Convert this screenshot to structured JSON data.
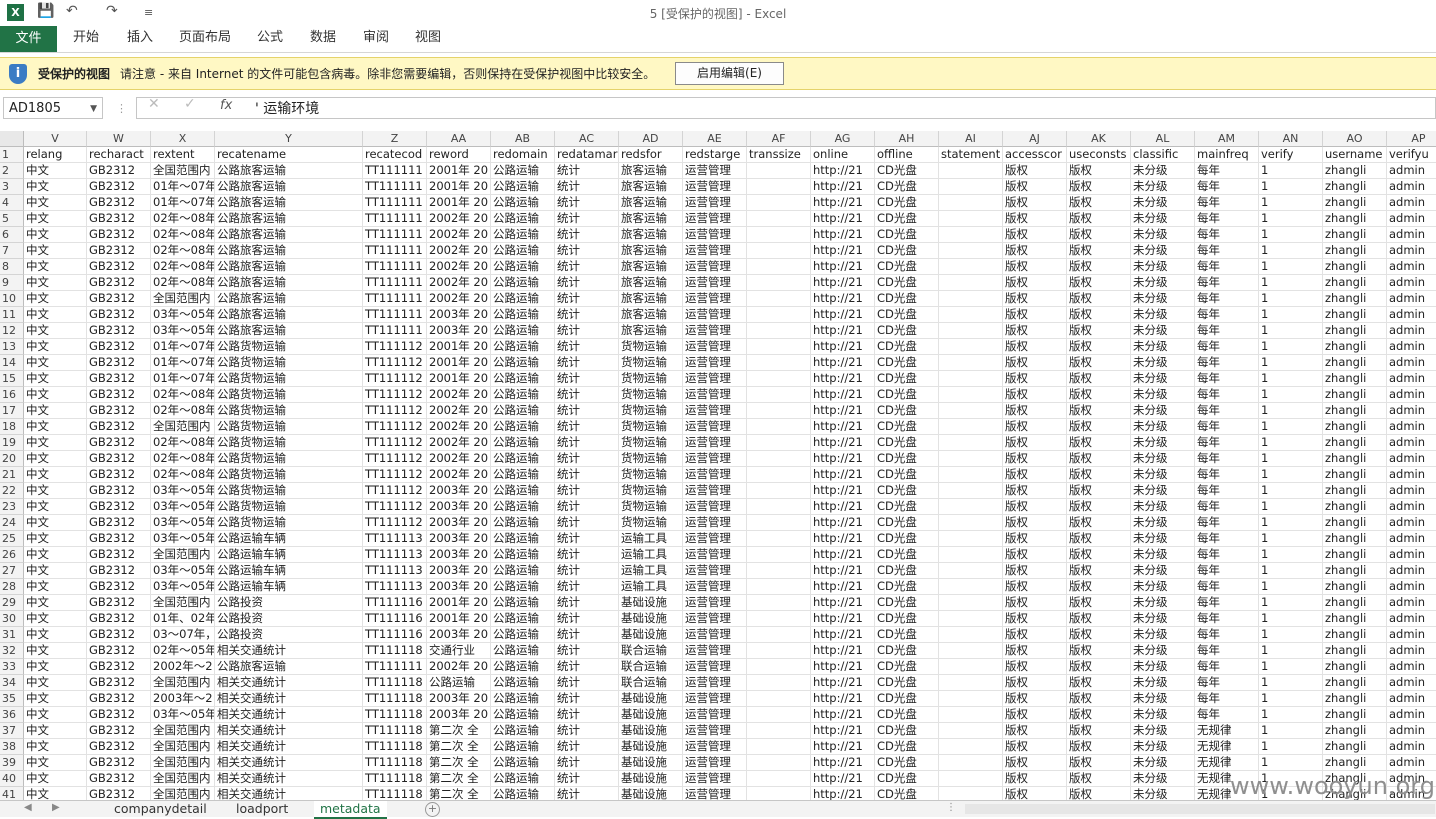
{
  "app": {
    "title": "5  [受保护的视图] - Excel",
    "logo": "X"
  },
  "quick_access": {
    "save_icon": "save-icon",
    "undo_icon": "undo-icon",
    "redo_icon": "redo-icon",
    "more": "≡"
  },
  "ribbon": {
    "file": "文件",
    "tabs": [
      "开始",
      "插入",
      "页面布局",
      "公式",
      "数据",
      "审阅",
      "视图"
    ]
  },
  "protected_bar": {
    "title": "受保护的视图",
    "message": "请注意 - 来自 Internet 的文件可能包含病毒。除非您需要编辑，否则保持在受保护视图中比较安全。",
    "button": "启用编辑(E)"
  },
  "formula_bar": {
    "name_box": "AD1805",
    "fx": "fx",
    "value": "' 运输环境"
  },
  "columns": [
    "V",
    "W",
    "X",
    "Y",
    "Z",
    "AA",
    "AB",
    "AC",
    "AD",
    "AE",
    "AF",
    "AG",
    "AH",
    "AI",
    "AJ",
    "AK",
    "AL",
    "AM",
    "AN",
    "AO",
    "AP"
  ],
  "header_row": [
    "relang",
    "recharact",
    "rextent",
    "recatename",
    "recatecod",
    "reword",
    "redomain",
    "redatamar",
    "redsfor",
    "redstarge",
    "transsize",
    "online",
    "offline",
    "statement",
    "accesscor",
    "useconsts",
    "classific",
    "mainfreq",
    "verify",
    "username",
    "verifyu"
  ],
  "rows": [
    [
      "1"
    ],
    [
      "2",
      "中文",
      "GB2312",
      "全国范围内",
      "公路旅客运输",
      "TT111111",
      "2001年  20",
      "公路运输",
      "统计",
      "旅客运输",
      "运营管理",
      "",
      "http://21",
      "CD光盘",
      "",
      "版权",
      "版权",
      "未分级",
      "每年",
      "1",
      "zhangli",
      "admin"
    ],
    [
      "3",
      "中文",
      "GB2312",
      "01年～07年",
      "公路旅客运输",
      "TT111111",
      "2001年  20",
      "公路运输",
      "统计",
      "旅客运输",
      "运营管理",
      "",
      "http://21",
      "CD光盘",
      "",
      "版权",
      "版权",
      "未分级",
      "每年",
      "1",
      "zhangli",
      "admin"
    ],
    [
      "4",
      "中文",
      "GB2312",
      "01年～07年",
      "公路旅客运输",
      "TT111111",
      "2001年  20",
      "公路运输",
      "统计",
      "旅客运输",
      "运营管理",
      "",
      "http://21",
      "CD光盘",
      "",
      "版权",
      "版权",
      "未分级",
      "每年",
      "1",
      "zhangli",
      "admin"
    ],
    [
      "5",
      "中文",
      "GB2312",
      "02年～08年",
      "公路旅客运输",
      "TT111111",
      "2002年  20",
      "公路运输",
      "统计",
      "旅客运输",
      "运营管理",
      "",
      "http://21",
      "CD光盘",
      "",
      "版权",
      "版权",
      "未分级",
      "每年",
      "1",
      "zhangli",
      "admin"
    ],
    [
      "6",
      "中文",
      "GB2312",
      "02年～08年",
      "公路旅客运输",
      "TT111111",
      "2002年  20",
      "公路运输",
      "统计",
      "旅客运输",
      "运营管理",
      "",
      "http://21",
      "CD光盘",
      "",
      "版权",
      "版权",
      "未分级",
      "每年",
      "1",
      "zhangli",
      "admin"
    ],
    [
      "7",
      "中文",
      "GB2312",
      "02年～08年",
      "公路旅客运输",
      "TT111111",
      "2002年  20",
      "公路运输",
      "统计",
      "旅客运输",
      "运营管理",
      "",
      "http://21",
      "CD光盘",
      "",
      "版权",
      "版权",
      "未分级",
      "每年",
      "1",
      "zhangli",
      "admin"
    ],
    [
      "8",
      "中文",
      "GB2312",
      "02年～08年",
      "公路旅客运输",
      "TT111111",
      "2002年  20",
      "公路运输",
      "统计",
      "旅客运输",
      "运营管理",
      "",
      "http://21",
      "CD光盘",
      "",
      "版权",
      "版权",
      "未分级",
      "每年",
      "1",
      "zhangli",
      "admin"
    ],
    [
      "9",
      "中文",
      "GB2312",
      "02年～08年",
      "公路旅客运输",
      "TT111111",
      "2002年  20",
      "公路运输",
      "统计",
      "旅客运输",
      "运营管理",
      "",
      "http://21",
      "CD光盘",
      "",
      "版权",
      "版权",
      "未分级",
      "每年",
      "1",
      "zhangli",
      "admin"
    ],
    [
      "10",
      "中文",
      "GB2312",
      "全国范围内",
      "公路旅客运输",
      "TT111111",
      "2002年  20",
      "公路运输",
      "统计",
      "旅客运输",
      "运营管理",
      "",
      "http://21",
      "CD光盘",
      "",
      "版权",
      "版权",
      "未分级",
      "每年",
      "1",
      "zhangli",
      "admin"
    ],
    [
      "11",
      "中文",
      "GB2312",
      "03年～05年",
      "公路旅客运输",
      "TT111111",
      "2003年  20",
      "公路运输",
      "统计",
      "旅客运输",
      "运营管理",
      "",
      "http://21",
      "CD光盘",
      "",
      "版权",
      "版权",
      "未分级",
      "每年",
      "1",
      "zhangli",
      "admin"
    ],
    [
      "12",
      "中文",
      "GB2312",
      "03年～05年",
      "公路旅客运输",
      "TT111111",
      "2003年  20",
      "公路运输",
      "统计",
      "旅客运输",
      "运营管理",
      "",
      "http://21",
      "CD光盘",
      "",
      "版权",
      "版权",
      "未分级",
      "每年",
      "1",
      "zhangli",
      "admin"
    ],
    [
      "13",
      "中文",
      "GB2312",
      "01年～07年",
      "公路货物运输",
      "TT111112",
      "2001年  20",
      "公路运输",
      "统计",
      "货物运输",
      "运营管理",
      "",
      "http://21",
      "CD光盘",
      "",
      "版权",
      "版权",
      "未分级",
      "每年",
      "1",
      "zhangli",
      "admin"
    ],
    [
      "14",
      "中文",
      "GB2312",
      "01年～07年",
      "公路货物运输",
      "TT111112",
      "2001年  20",
      "公路运输",
      "统计",
      "货物运输",
      "运营管理",
      "",
      "http://21",
      "CD光盘",
      "",
      "版权",
      "版权",
      "未分级",
      "每年",
      "1",
      "zhangli",
      "admin"
    ],
    [
      "15",
      "中文",
      "GB2312",
      "01年～07年",
      "公路货物运输",
      "TT111112",
      "2001年  20",
      "公路运输",
      "统计",
      "货物运输",
      "运营管理",
      "",
      "http://21",
      "CD光盘",
      "",
      "版权",
      "版权",
      "未分级",
      "每年",
      "1",
      "zhangli",
      "admin"
    ],
    [
      "16",
      "中文",
      "GB2312",
      "02年～08年",
      "公路货物运输",
      "TT111112",
      "2002年  20",
      "公路运输",
      "统计",
      "货物运输",
      "运营管理",
      "",
      "http://21",
      "CD光盘",
      "",
      "版权",
      "版权",
      "未分级",
      "每年",
      "1",
      "zhangli",
      "admin"
    ],
    [
      "17",
      "中文",
      "GB2312",
      "02年～08年",
      "公路货物运输",
      "TT111112",
      "2002年  20",
      "公路运输",
      "统计",
      "货物运输",
      "运营管理",
      "",
      "http://21",
      "CD光盘",
      "",
      "版权",
      "版权",
      "未分级",
      "每年",
      "1",
      "zhangli",
      "admin"
    ],
    [
      "18",
      "中文",
      "GB2312",
      "全国范围内",
      "公路货物运输",
      "TT111112",
      "2002年  20",
      "公路运输",
      "统计",
      "货物运输",
      "运营管理",
      "",
      "http://21",
      "CD光盘",
      "",
      "版权",
      "版权",
      "未分级",
      "每年",
      "1",
      "zhangli",
      "admin"
    ],
    [
      "19",
      "中文",
      "GB2312",
      "02年～08年",
      "公路货物运输",
      "TT111112",
      "2002年  20",
      "公路运输",
      "统计",
      "货物运输",
      "运营管理",
      "",
      "http://21",
      "CD光盘",
      "",
      "版权",
      "版权",
      "未分级",
      "每年",
      "1",
      "zhangli",
      "admin"
    ],
    [
      "20",
      "中文",
      "GB2312",
      "02年～08年",
      "公路货物运输",
      "TT111112",
      "2002年  20",
      "公路运输",
      "统计",
      "货物运输",
      "运营管理",
      "",
      "http://21",
      "CD光盘",
      "",
      "版权",
      "版权",
      "未分级",
      "每年",
      "1",
      "zhangli",
      "admin"
    ],
    [
      "21",
      "中文",
      "GB2312",
      "02年～08年",
      "公路货物运输",
      "TT111112",
      "2002年  20",
      "公路运输",
      "统计",
      "货物运输",
      "运营管理",
      "",
      "http://21",
      "CD光盘",
      "",
      "版权",
      "版权",
      "未分级",
      "每年",
      "1",
      "zhangli",
      "admin"
    ],
    [
      "22",
      "中文",
      "GB2312",
      "03年～05年",
      "公路货物运输",
      "TT111112",
      "2003年  20",
      "公路运输",
      "统计",
      "货物运输",
      "运营管理",
      "",
      "http://21",
      "CD光盘",
      "",
      "版权",
      "版权",
      "未分级",
      "每年",
      "1",
      "zhangli",
      "admin"
    ],
    [
      "23",
      "中文",
      "GB2312",
      "03年～05年",
      "公路货物运输",
      "TT111112",
      "2003年  20",
      "公路运输",
      "统计",
      "货物运输",
      "运营管理",
      "",
      "http://21",
      "CD光盘",
      "",
      "版权",
      "版权",
      "未分级",
      "每年",
      "1",
      "zhangli",
      "admin"
    ],
    [
      "24",
      "中文",
      "GB2312",
      "03年～05年",
      "公路货物运输",
      "TT111112",
      "2003年  20",
      "公路运输",
      "统计",
      "货物运输",
      "运营管理",
      "",
      "http://21",
      "CD光盘",
      "",
      "版权",
      "版权",
      "未分级",
      "每年",
      "1",
      "zhangli",
      "admin"
    ],
    [
      "25",
      "中文",
      "GB2312",
      "03年～05年",
      "公路运输车辆",
      "TT111113",
      "2003年  20",
      "公路运输",
      "统计",
      "运输工具",
      "运营管理",
      "",
      "http://21",
      "CD光盘",
      "",
      "版权",
      "版权",
      "未分级",
      "每年",
      "1",
      "zhangli",
      "admin"
    ],
    [
      "26",
      "中文",
      "GB2312",
      "全国范围内",
      "公路运输车辆",
      "TT111113",
      "2003年  20",
      "公路运输",
      "统计",
      "运输工具",
      "运营管理",
      "",
      "http://21",
      "CD光盘",
      "",
      "版权",
      "版权",
      "未分级",
      "每年",
      "1",
      "zhangli",
      "admin"
    ],
    [
      "27",
      "中文",
      "GB2312",
      "03年～05年",
      "公路运输车辆",
      "TT111113",
      "2003年  20",
      "公路运输",
      "统计",
      "运输工具",
      "运营管理",
      "",
      "http://21",
      "CD光盘",
      "",
      "版权",
      "版权",
      "未分级",
      "每年",
      "1",
      "zhangli",
      "admin"
    ],
    [
      "28",
      "中文",
      "GB2312",
      "03年～05年",
      "公路运输车辆",
      "TT111113",
      "2003年  20",
      "公路运输",
      "统计",
      "运输工具",
      "运营管理",
      "",
      "http://21",
      "CD光盘",
      "",
      "版权",
      "版权",
      "未分级",
      "每年",
      "1",
      "zhangli",
      "admin"
    ],
    [
      "29",
      "中文",
      "GB2312",
      "全国范围内",
      "公路投资",
      "TT111116",
      "2001年  20",
      "公路运输",
      "统计",
      "基础设施",
      "运营管理",
      "",
      "http://21",
      "CD光盘",
      "",
      "版权",
      "版权",
      "未分级",
      "每年",
      "1",
      "zhangli",
      "admin"
    ],
    [
      "30",
      "中文",
      "GB2312",
      "01年、02年",
      "公路投资",
      "TT111116",
      "2001年  20",
      "公路运输",
      "统计",
      "基础设施",
      "运营管理",
      "",
      "http://21",
      "CD光盘",
      "",
      "版权",
      "版权",
      "未分级",
      "每年",
      "1",
      "zhangli",
      "admin"
    ],
    [
      "31",
      "中文",
      "GB2312",
      "03～07年，",
      "公路投资",
      "TT111116",
      "2003年  20",
      "公路运输",
      "统计",
      "基础设施",
      "运营管理",
      "",
      "http://21",
      "CD光盘",
      "",
      "版权",
      "版权",
      "未分级",
      "每年",
      "1",
      "zhangli",
      "admin"
    ],
    [
      "32",
      "中文",
      "GB2312",
      "02年～05年",
      "相关交通统计",
      "TT111118",
      "交通行业  ",
      "公路运输",
      "统计",
      "联合运输",
      "运营管理",
      "",
      "http://21",
      "CD光盘",
      "",
      "版权",
      "版权",
      "未分级",
      "每年",
      "1",
      "zhangli",
      "admin"
    ],
    [
      "33",
      "中文",
      "GB2312",
      "2002年～2",
      "公路旅客运输",
      "TT111111",
      "2002年  20",
      "公路运输",
      "统计",
      "联合运输",
      "运营管理",
      "",
      "http://21",
      "CD光盘",
      "",
      "版权",
      "版权",
      "未分级",
      "每年",
      "1",
      "zhangli",
      "admin"
    ],
    [
      "34",
      "中文",
      "GB2312",
      "全国范围内",
      "相关交通统计",
      "TT111118",
      "公路运输  ",
      "公路运输",
      "统计",
      "联合运输",
      "运营管理",
      "",
      "http://21",
      "CD光盘",
      "",
      "版权",
      "版权",
      "未分级",
      "每年",
      "1",
      "zhangli",
      "admin"
    ],
    [
      "35",
      "中文",
      "GB2312",
      "2003年～2",
      "相关交通统计",
      "TT111118",
      "2003年  20",
      "公路运输",
      "统计",
      "基础设施",
      "运营管理",
      "",
      "http://21",
      "CD光盘",
      "",
      "版权",
      "版权",
      "未分级",
      "每年",
      "1",
      "zhangli",
      "admin"
    ],
    [
      "36",
      "中文",
      "GB2312",
      "03年～05年",
      "相关交通统计",
      "TT111118",
      "2003年  20",
      "公路运输",
      "统计",
      "基础设施",
      "运营管理",
      "",
      "http://21",
      "CD光盘",
      "",
      "版权",
      "版权",
      "未分级",
      "每年",
      "1",
      "zhangli",
      "admin"
    ],
    [
      "37",
      "中文",
      "GB2312",
      "全国范围内",
      "相关交通统计",
      "TT111118",
      "第二次  全",
      "公路运输",
      "统计",
      "基础设施",
      "运营管理",
      "",
      "http://21",
      "CD光盘",
      "",
      "版权",
      "版权",
      "未分级",
      "无规律",
      "1",
      "zhangli",
      "admin"
    ],
    [
      "38",
      "中文",
      "GB2312",
      "全国范围内",
      "相关交通统计",
      "TT111118",
      "第二次  全",
      "公路运输",
      "统计",
      "基础设施",
      "运营管理",
      "",
      "http://21",
      "CD光盘",
      "",
      "版权",
      "版权",
      "未分级",
      "无规律",
      "1",
      "zhangli",
      "admin"
    ],
    [
      "39",
      "中文",
      "GB2312",
      "全国范围内",
      "相关交通统计",
      "TT111118",
      "第二次  全",
      "公路运输",
      "统计",
      "基础设施",
      "运营管理",
      "",
      "http://21",
      "CD光盘",
      "",
      "版权",
      "版权",
      "未分级",
      "无规律",
      "1",
      "zhangli",
      "admin"
    ],
    [
      "40",
      "中文",
      "GB2312",
      "全国范围内",
      "相关交通统计",
      "TT111118",
      "第二次  全",
      "公路运输",
      "统计",
      "基础设施",
      "运营管理",
      "",
      "http://21",
      "CD光盘",
      "",
      "版权",
      "版权",
      "未分级",
      "无规律",
      "1",
      "zhangli",
      "admin"
    ],
    [
      "41",
      "中文",
      "GB2312",
      "全国范围内",
      "相关交通统计",
      "TT111118",
      "第二次  全",
      "公路运输",
      "统计",
      "基础设施",
      "运营管理",
      "",
      "http://21",
      "CD光盘",
      "",
      "版权",
      "版权",
      "未分级",
      "无规律",
      "1",
      "zhangli",
      "admin"
    ]
  ],
  "sheets": [
    "companydetail",
    "loadport",
    "metadata"
  ],
  "active_sheet": "metadata",
  "watermark": "www.wooyun.org",
  "colors": {
    "excel_green": "#217346",
    "bar_yellow": "#fff8c4"
  }
}
